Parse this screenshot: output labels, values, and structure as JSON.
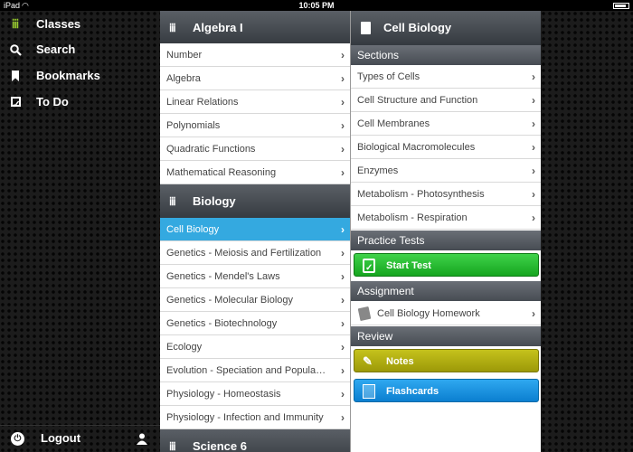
{
  "status_bar": {
    "device": "iPad",
    "time": "10:05 PM"
  },
  "sidebar": {
    "items": [
      {
        "label": "Classes",
        "icon": "classes-icon"
      },
      {
        "label": "Search",
        "icon": "search-icon"
      },
      {
        "label": "Bookmarks",
        "icon": "bookmark-icon"
      },
      {
        "label": "To Do",
        "icon": "checkbox-icon"
      }
    ],
    "logout_label": "Logout"
  },
  "classes": {
    "algebra": {
      "title": "Algebra I",
      "items": [
        "Number",
        "Algebra",
        "Linear Relations",
        "Polynomials",
        "Quadratic Functions",
        "Mathematical Reasoning"
      ]
    },
    "biology": {
      "title": "Biology",
      "items": [
        "Cell Biology",
        "Genetics - Meiosis and Fertilization",
        "Genetics - Mendel's Laws",
        "Genetics - Molecular Biology",
        "Genetics - Biotechnology",
        "Ecology",
        "Evolution - Speciation and Population Genetics",
        "Physiology - Homeostasis",
        "Physiology - Infection and Immunity"
      ],
      "selected_index": 0
    },
    "science": {
      "title": "Science 6"
    }
  },
  "detail": {
    "title": "Cell Biology",
    "sections_header": "Sections",
    "sections": [
      "Types of Cells",
      "Cell Structure and Function",
      "Cell Membranes",
      "Biological Macromolecules",
      "Enzymes",
      "Metabolism - Photosynthesis",
      "Metabolism - Respiration"
    ],
    "practice_header": "Practice Tests",
    "start_test_label": "Start Test",
    "assignment_header": "Assignment",
    "assignment_item": "Cell Biology Homework",
    "review_header": "Review",
    "notes_label": "Notes",
    "flashcards_label": "Flashcards"
  },
  "colors": {
    "selected_row": "#34a9e0",
    "start_test_button": "#22b52c",
    "notes_button": "#b3b012",
    "flashcards_button": "#1b95e0",
    "classes_icon": "#9acd32"
  }
}
